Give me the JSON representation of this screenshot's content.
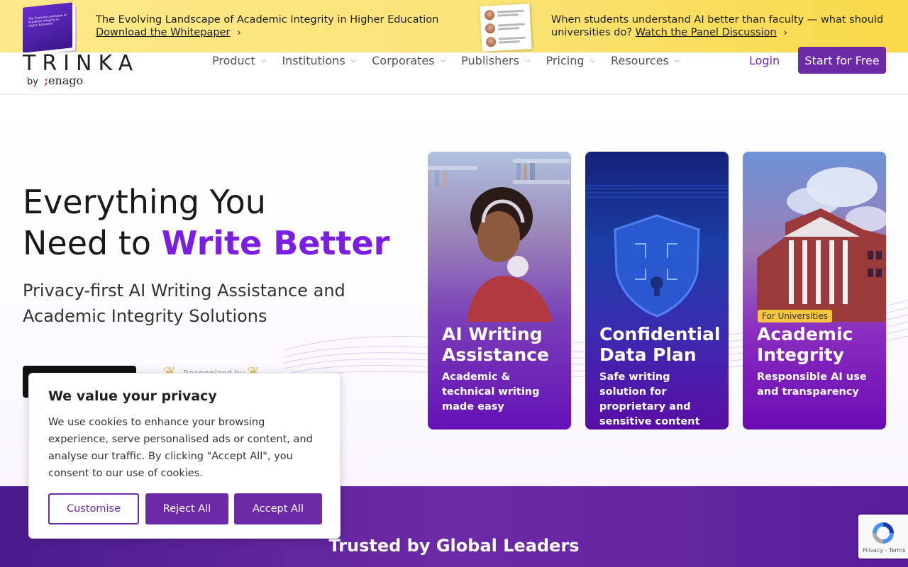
{
  "banner": {
    "promo1": {
      "title": "The Evolving Landscape of Academic Integrity in Higher Education",
      "link": "Download the Whitepaper",
      "thumb_text": "The Evolving Landscape of Academic Integrity in Higher Education"
    },
    "promo2": {
      "title": "When students understand AI better than faculty — what should",
      "title2": "universities do?",
      "link": "Watch the Panel Discussion"
    }
  },
  "header": {
    "logo": "TRINKA",
    "logo_by": "by",
    "logo_brand": "enago",
    "nav": [
      "Product",
      "Institutions",
      "Corporates",
      "Publishers",
      "Pricing",
      "Resources"
    ],
    "login": "Login",
    "cta": "Start for Free"
  },
  "hero": {
    "title_line1": "Everything You",
    "title_line2_plain": "Need to ",
    "title_line2_accent": "Write Better",
    "subtitle_line1": "Privacy-first AI Writing Assistance and",
    "subtitle_line2": "Academic Integrity Solutions",
    "recognized": "Recognized by"
  },
  "cards": [
    {
      "title": "AI Writing Assistance",
      "desc": "Academic & technical writing made easy",
      "badge": ""
    },
    {
      "title": "Confidential Data Plan",
      "desc": "Safe writing solution for proprietary and sensitive content",
      "badge": ""
    },
    {
      "title": "Academic Integrity",
      "desc": "Responsible AI use and transparency",
      "badge": "For Universities"
    }
  ],
  "trusted": {
    "title": "Trusted by Global Leaders"
  },
  "cookie": {
    "title": "We value your privacy",
    "text": "We use cookies to enhance your browsing experience, serve personalised ads or content, and analyse our traffic. By clicking \"Accept All\", you consent to our use of cookies.",
    "customise": "Customise",
    "reject": "Reject All",
    "accept": "Accept All"
  },
  "recaptcha": {
    "text": "Privacy - Terms"
  },
  "colors": {
    "brand_purple": "#6d2aa6",
    "accent_purple": "#7a1ee0",
    "banner_yellow": "#fbe479"
  }
}
